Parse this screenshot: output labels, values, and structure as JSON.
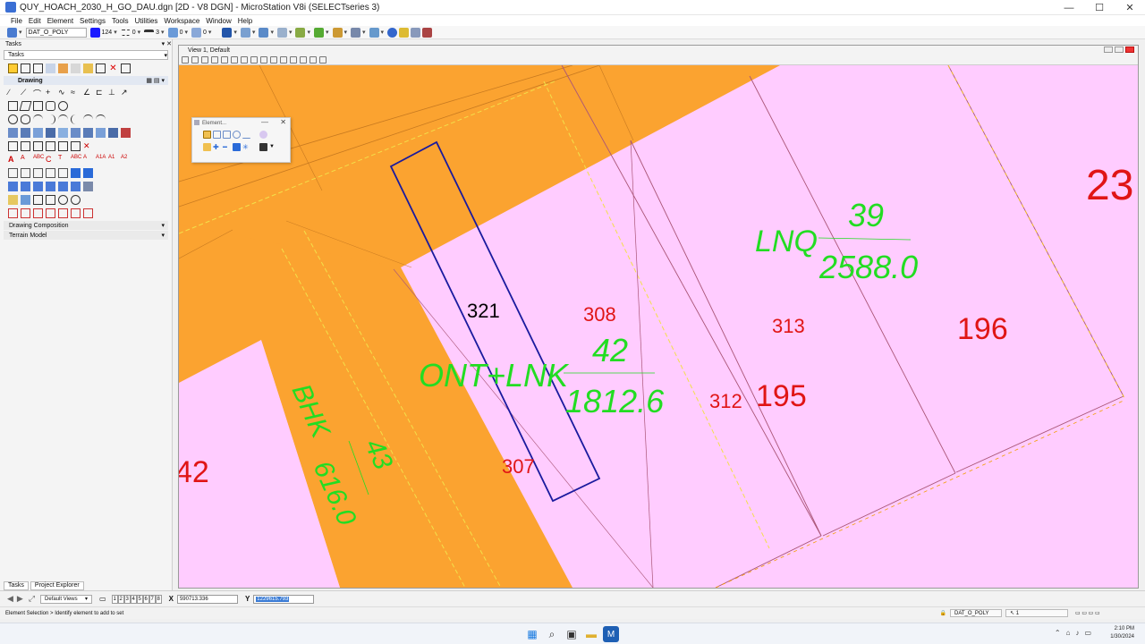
{
  "window": {
    "title": "QUY_HOACH_2030_H_GO_DAU.dgn [2D - V8 DGN] - MicroStation V8i (SELECTseries 3)",
    "minimize": "—",
    "maximize": "☐",
    "close": "✕"
  },
  "menu": [
    "File",
    "Edit",
    "Element",
    "Settings",
    "Tools",
    "Utilities",
    "Workspace",
    "Window",
    "Help"
  ],
  "toolbar": {
    "level": "DAT_O_POLY",
    "color_value": "124",
    "style_value": "0",
    "weight_value": "3",
    "transparency_value": "0",
    "priority_value": "0",
    "colors": {
      "color_swatch": "#1a1aff"
    }
  },
  "tasks_panel": {
    "header": "Tasks",
    "selector_value": "Tasks",
    "section_drawing": "Drawing",
    "section_drawing_composition": "Drawing Composition",
    "section_terrain_model": "Terrain Model",
    "tab_tasks": "Tasks",
    "tab_project_explorer": "Project Explorer"
  },
  "view": {
    "title": "View 1, Default"
  },
  "element_dialog": {
    "title": "Element..."
  },
  "map_labels": {
    "parcel_321": "321",
    "parcel_308": "308",
    "parcel_313": "313",
    "parcel_196": "196",
    "parcel_312": "312",
    "parcel_195": "195",
    "parcel_307": "307",
    "parcel_42": "42",
    "parcel_23": "23",
    "lnq_code": "LNQ",
    "lnq_number": "39",
    "lnq_area": "2588.0",
    "ont_code": "ONT+LNK",
    "ont_number": "42",
    "ont_area": "1812.6",
    "bhk_code": "BHK",
    "bhk_number": "43",
    "bhk_area": "616.0",
    "colors": {
      "road": "#fba330",
      "land": "#ffccff",
      "green_text": "#22dd22",
      "red_text": "#e01515",
      "selection": "#1a1a9e"
    }
  },
  "statusbar": {
    "view_set": "Default Views",
    "pages": [
      "1",
      "2",
      "3",
      "4",
      "5",
      "6",
      "7",
      "8"
    ],
    "x_label": "X",
    "x_value": "590713.336",
    "y_label": "Y",
    "y_value": "1229615.793",
    "prompt": "Element Selection > Identify element to add to set",
    "active_level": "DAT_O_POLY",
    "snap_value": "1"
  },
  "taskbar": {
    "time": "2:10 PM",
    "date": "1/30/2024"
  }
}
